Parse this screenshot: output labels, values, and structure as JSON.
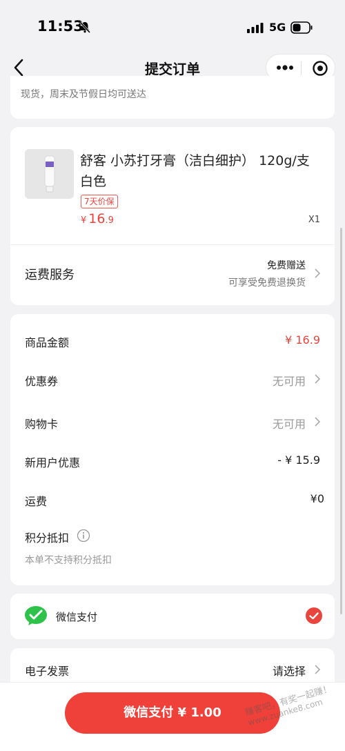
{
  "status_bar": {
    "time": "11:53",
    "network": "5G"
  },
  "nav": {
    "title": "提交订单"
  },
  "delivery_note": "现货，周末及节假日均可送达",
  "product": {
    "name": "舒客 小苏打牙膏（洁白细护） 120g/支 白色",
    "tag": "7天价保",
    "currency": "¥",
    "price_int": "16",
    "price_dec": ".9",
    "qty": "X1"
  },
  "shipping": {
    "label": "运费服务",
    "value": "免费赠送",
    "sub": "可享受免费退换货"
  },
  "summary": {
    "goods_label": "商品金额",
    "goods_value": "¥ 16.9",
    "coupon_label": "优惠券",
    "coupon_value": "无可用",
    "card_label": "购物卡",
    "card_value": "无可用",
    "newuser_label": "新用户优惠",
    "newuser_value": "- ¥ 15.9",
    "freight_label": "运费",
    "freight_value": "¥0",
    "points_label": "积分抵扣",
    "points_note": "本单不支持积分抵扣"
  },
  "payment": {
    "label": "微信支付"
  },
  "invoice": {
    "label": "电子发票",
    "value": "请选择"
  },
  "pay_button": "微信支付 ¥ 1.00",
  "watermark": [
    "赚客吧，有奖一起赚！",
    "www.zuanke8.com"
  ],
  "colors": {
    "accent_red": "#e8453c",
    "button_red": "#f0403a",
    "wechat_green": "#2ec24b"
  }
}
